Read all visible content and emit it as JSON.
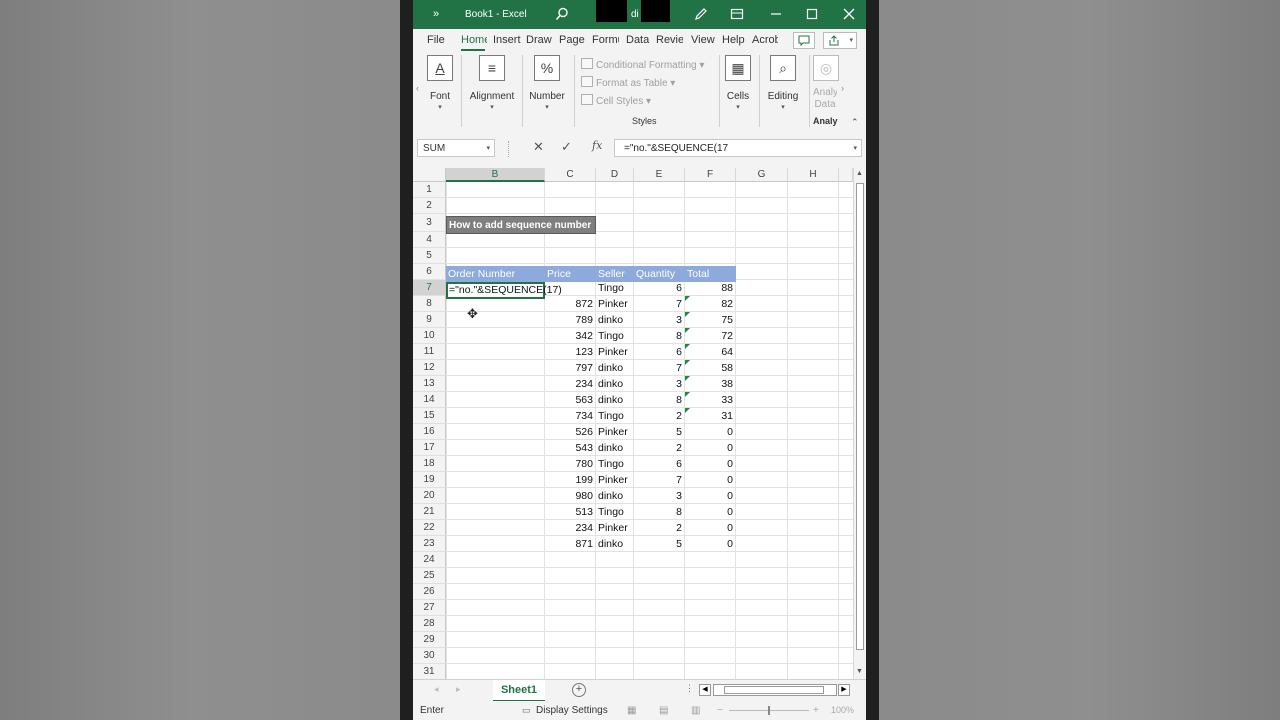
{
  "titlebar": {
    "title": "Book1 - Excel",
    "obscured_text": "di",
    "colors": {
      "accent": "#217346"
    }
  },
  "ribbon_tabs": [
    "File",
    "Home",
    "Insert",
    "Draw",
    "Page",
    "Formulas",
    "Data",
    "Review",
    "View",
    "Help",
    "Acrobat"
  ],
  "ribbon": {
    "font": "Font",
    "alignment": "Alignment",
    "number": "Number",
    "conditional_formatting": "Conditional Formatting",
    "format_as_table": "Format as Table",
    "cell_styles": "Cell Styles",
    "styles_group": "Styles",
    "cells": "Cells",
    "editing": "Editing",
    "analyze": "Analy Data",
    "analyze_group": "Analy"
  },
  "formula_bar": {
    "name_box": "SUM",
    "formula": "=\"no.\"&SEQUENCE(17"
  },
  "sheet": {
    "columns": [
      "B",
      "C",
      "D",
      "E",
      "F",
      "G",
      "H"
    ],
    "title": "How to add sequence number",
    "headers": [
      "Order Number",
      "Price",
      "Seller",
      "Quantity",
      "Total"
    ],
    "editing_cell": "=\"no.\"&SEQUENCE(17)",
    "rows": [
      {
        "row": "7",
        "price": "",
        "seller": "Tingo",
        "qty": "6",
        "total": "88"
      },
      {
        "row": "8",
        "price": "872",
        "seller": "Pinker",
        "qty": "7",
        "total": "82"
      },
      {
        "row": "9",
        "price": "789",
        "seller": "dinko",
        "qty": "3",
        "total": "75"
      },
      {
        "row": "10",
        "price": "342",
        "seller": "Tingo",
        "qty": "8",
        "total": "72"
      },
      {
        "row": "11",
        "price": "123",
        "seller": "Pinker",
        "qty": "6",
        "total": "64"
      },
      {
        "row": "12",
        "price": "797",
        "seller": "dinko",
        "qty": "7",
        "total": "58"
      },
      {
        "row": "13",
        "price": "234",
        "seller": "dinko",
        "qty": "3",
        "total": "38"
      },
      {
        "row": "14",
        "price": "563",
        "seller": "dinko",
        "qty": "8",
        "total": "33"
      },
      {
        "row": "15",
        "price": "734",
        "seller": "Tingo",
        "qty": "2",
        "total": "31"
      },
      {
        "row": "16",
        "price": "526",
        "seller": "Pinker",
        "qty": "5",
        "total": "0"
      },
      {
        "row": "17",
        "price": "543",
        "seller": "dinko",
        "qty": "2",
        "total": "0"
      },
      {
        "row": "18",
        "price": "780",
        "seller": "Tingo",
        "qty": "6",
        "total": "0"
      },
      {
        "row": "19",
        "price": "199",
        "seller": "Pinker",
        "qty": "7",
        "total": "0"
      },
      {
        "row": "20",
        "price": "980",
        "seller": "dinko",
        "qty": "3",
        "total": "0"
      },
      {
        "row": "21",
        "price": "513",
        "seller": "Tingo",
        "qty": "8",
        "total": "0"
      },
      {
        "row": "22",
        "price": "234",
        "seller": "Pinker",
        "qty": "2",
        "total": "0"
      },
      {
        "row": "23",
        "price": "871",
        "seller": "dinko",
        "qty": "5",
        "total": "0"
      }
    ],
    "row_numbers": [
      "1",
      "2",
      "3",
      "4",
      "5",
      "6",
      "7",
      "8",
      "9",
      "10",
      "11",
      "12",
      "13",
      "14",
      "15",
      "16",
      "17",
      "18",
      "19",
      "20",
      "21",
      "22",
      "23",
      "24",
      "25",
      "26",
      "27",
      "28",
      "29",
      "30",
      "31"
    ]
  },
  "sheet_tabs": {
    "active": "Sheet1"
  },
  "status": {
    "mode": "Enter",
    "display_settings": "Display Settings",
    "zoom": "100%"
  }
}
